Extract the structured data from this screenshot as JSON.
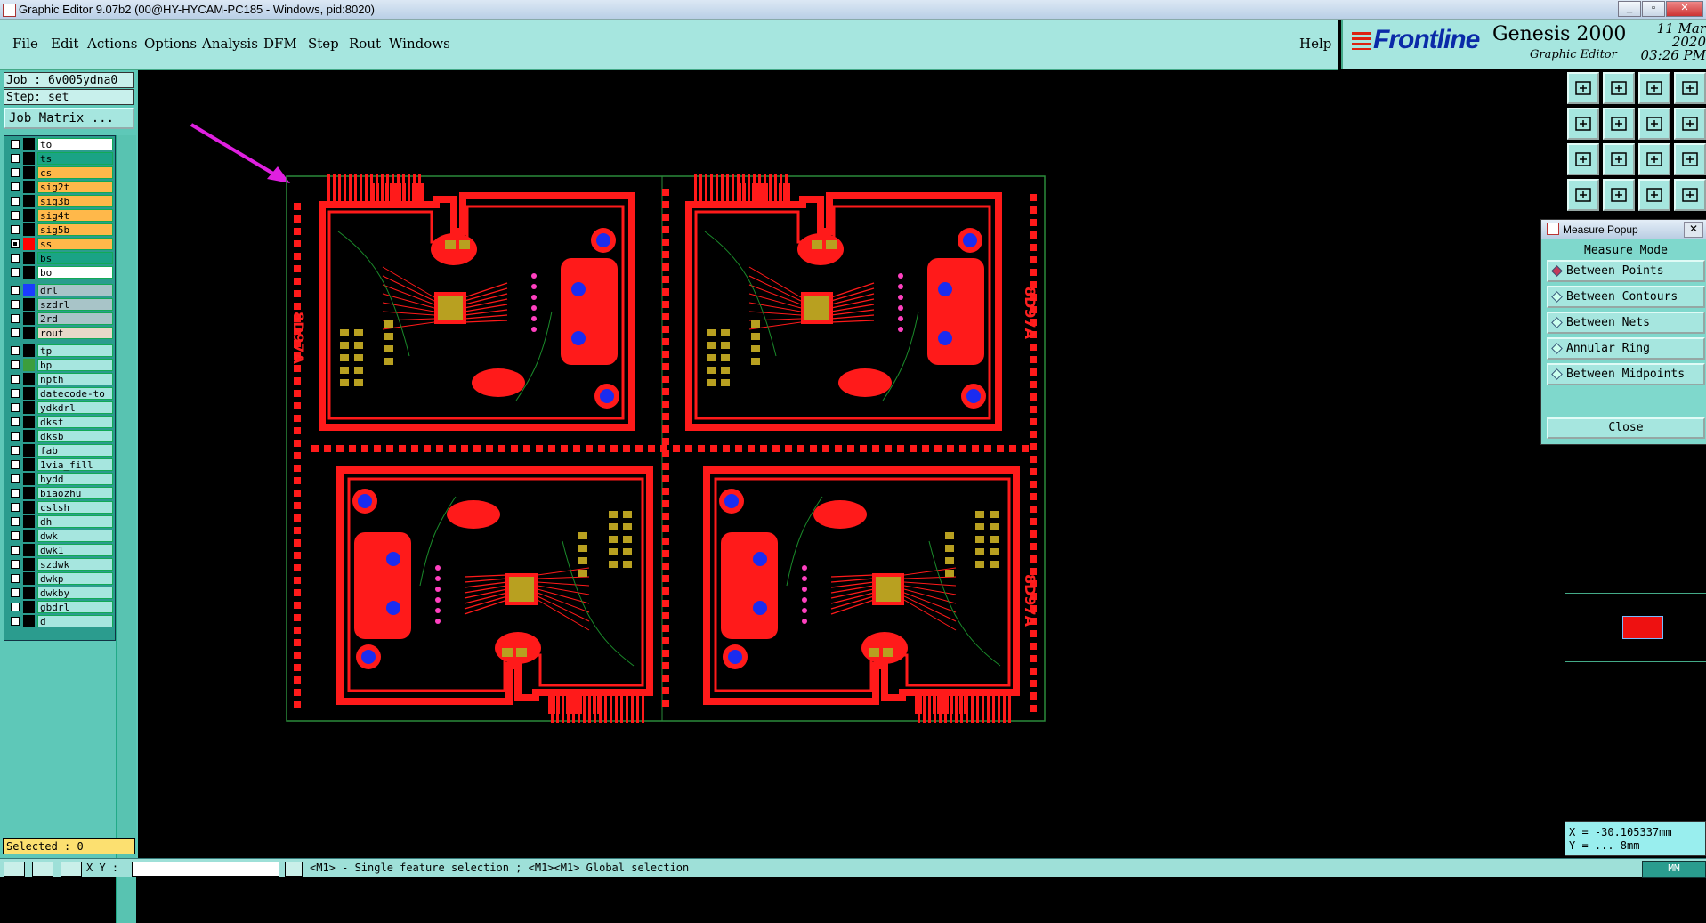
{
  "window": {
    "title": "Graphic Editor 9.07b2 (00@HY-HYCAM-PC185 - Windows, pid:8020)"
  },
  "menu": {
    "items": [
      "File",
      "Edit",
      "Actions",
      "Options",
      "Analysis",
      "DFM",
      "Step",
      "Rout",
      "Windows"
    ],
    "help": "Help"
  },
  "brand": {
    "company": "Frontline",
    "product": "Genesis 2000",
    "subtitle": "Graphic Editor",
    "date": "11 Mar 2020",
    "time": "03:26 PM"
  },
  "job": {
    "job": "Job : 6v005ydna0",
    "step": "Step: set",
    "matrix_button": "Job Matrix ..."
  },
  "layers": [
    {
      "name": "to",
      "color": "#ffffff",
      "checked": false
    },
    {
      "name": "ts",
      "color": "#1aa386",
      "checked": false
    },
    {
      "name": "cs",
      "color": "#ffb84a",
      "checked": false
    },
    {
      "name": "sig2t",
      "color": "#ffb84a",
      "checked": false
    },
    {
      "name": "sig3b",
      "color": "#ffb84a",
      "checked": false
    },
    {
      "name": "sig4t",
      "color": "#ffb84a",
      "checked": false
    },
    {
      "name": "sig5b",
      "color": "#ffb84a",
      "checked": false
    },
    {
      "name": "ss",
      "color": "#ffb84a",
      "checked": true,
      "swatch": "#ff0000"
    },
    {
      "name": "bs",
      "color": "#1aa386",
      "checked": false
    },
    {
      "name": "bo",
      "color": "#ffffff",
      "checked": false
    },
    {
      "name": "drl",
      "color": "#a8c4c8",
      "checked": false,
      "swatch": "#1b3cff"
    },
    {
      "name": "szdrl",
      "color": "#a8c4c8",
      "checked": false
    },
    {
      "name": "2rd",
      "color": "#a8c4c8",
      "checked": false
    },
    {
      "name": "rout",
      "color": "#e8d8c8",
      "checked": false
    },
    {
      "name": "tp",
      "color": "#a6e6df",
      "checked": false
    },
    {
      "name": "bp",
      "color": "#a6e6df",
      "checked": false,
      "swatch": "#3c9e3c"
    },
    {
      "name": "npth",
      "color": "#a6e6df",
      "checked": false
    },
    {
      "name": "datecode-to",
      "color": "#a6e6df",
      "checked": false
    },
    {
      "name": "ydkdrl",
      "color": "#a6e6df",
      "checked": false
    },
    {
      "name": "dkst",
      "color": "#a6e6df",
      "checked": false
    },
    {
      "name": "dksb",
      "color": "#a6e6df",
      "checked": false
    },
    {
      "name": "fab",
      "color": "#a6e6df",
      "checked": false
    },
    {
      "name": "1via_fill",
      "color": "#a6e6df",
      "checked": false
    },
    {
      "name": "hydd",
      "color": "#a6e6df",
      "checked": false
    },
    {
      "name": "biaozhu",
      "color": "#a6e6df",
      "checked": false
    },
    {
      "name": "cslsh",
      "color": "#a6e6df",
      "checked": false
    },
    {
      "name": "dh",
      "color": "#a6e6df",
      "checked": false
    },
    {
      "name": "dwk",
      "color": "#a6e6df",
      "checked": false
    },
    {
      "name": "dwk1",
      "color": "#a6e6df",
      "checked": false
    },
    {
      "name": "szdwk",
      "color": "#a6e6df",
      "checked": false
    },
    {
      "name": "dwkp",
      "color": "#a6e6df",
      "checked": false
    },
    {
      "name": "dwkby",
      "color": "#a6e6df",
      "checked": false
    },
    {
      "name": "gbdrl",
      "color": "#a6e6df",
      "checked": false
    },
    {
      "name": "d",
      "color": "#a6e6df",
      "checked": false
    }
  ],
  "status": {
    "selected": "Selected : 0",
    "xy_label": "X Y :",
    "hint": "<M1> - Single feature selection ; <M1><M1> Global selection",
    "units": "MM"
  },
  "measure_popup": {
    "title": "Measure Popup",
    "heading": "Measure Mode",
    "options": [
      "Between Points",
      "Between Contours",
      "Between Nets",
      "Annular Ring",
      "Between Midpoints"
    ],
    "selected": "Between Points",
    "close": "Close"
  },
  "coords": {
    "x": "X = -30.105337mm",
    "y": "Y = ... 8mm"
  },
  "panel_text": "8D97A",
  "colors": {
    "accent": "#a6e6df",
    "copper": "#ff0000",
    "annotation_arrow": "#e020e0",
    "pad_gold": "#b8a020",
    "via_blue": "#1a2cf0",
    "via_pink": "#ff40c0"
  }
}
